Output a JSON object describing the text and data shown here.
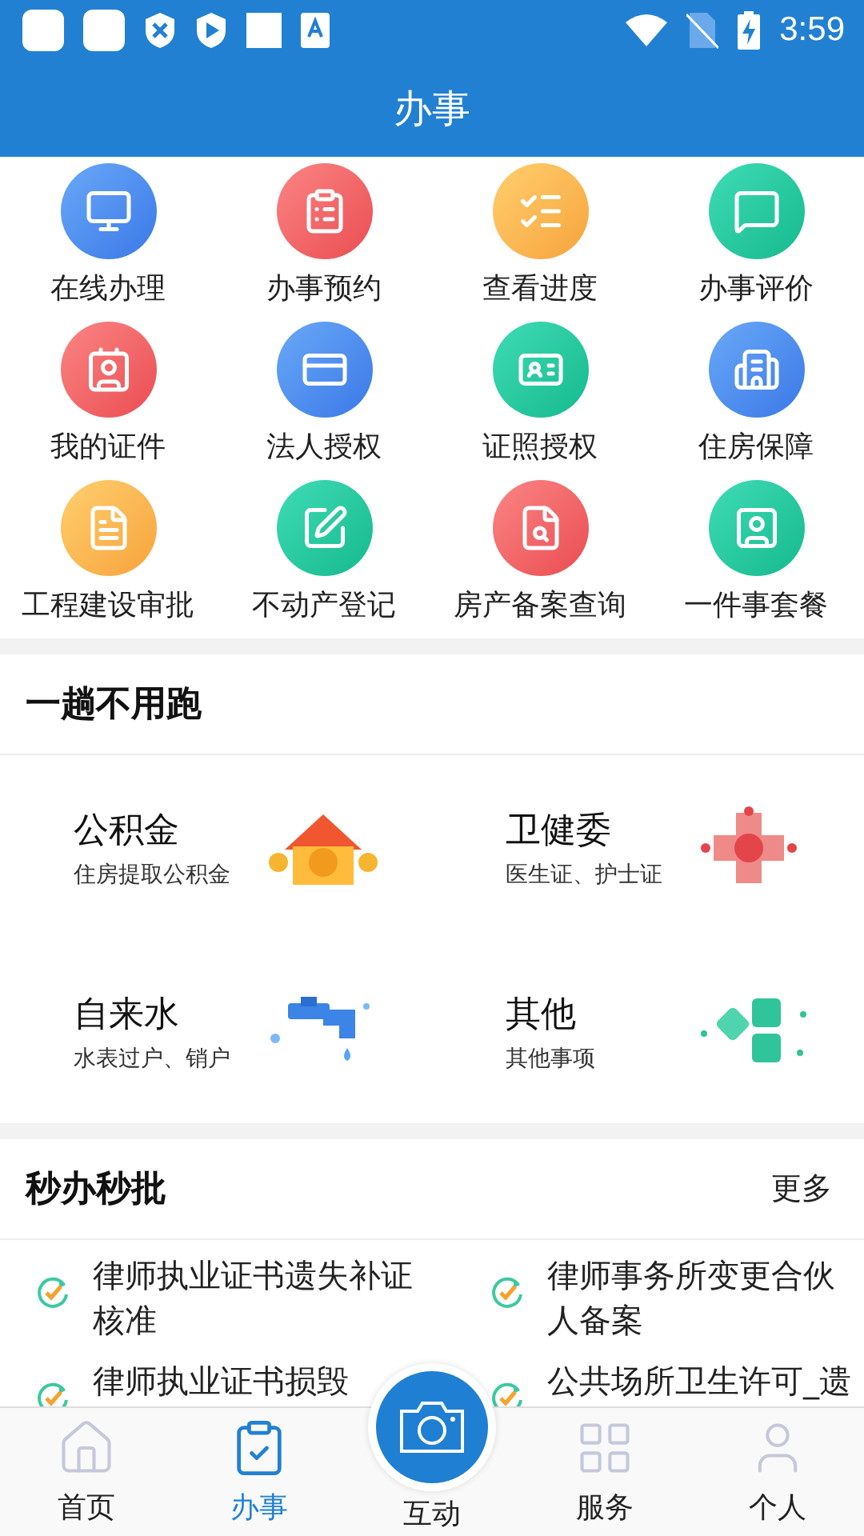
{
  "status_bar": {
    "time": "3:59"
  },
  "header": {
    "title": "办事"
  },
  "services": [
    {
      "label": "在线办理"
    },
    {
      "label": "办事预约"
    },
    {
      "label": "查看进度"
    },
    {
      "label": "办事评价"
    },
    {
      "label": "我的证件"
    },
    {
      "label": "法人授权"
    },
    {
      "label": "证照授权"
    },
    {
      "label": "住房保障"
    },
    {
      "label": "工程建设审批"
    },
    {
      "label": "不动产登记"
    },
    {
      "label": "房产备案查询"
    },
    {
      "label": "一件事套餐"
    }
  ],
  "no_trip": {
    "title": "一趟不用跑",
    "cards": [
      {
        "kind": "house",
        "title": "公积金",
        "subtitle": "住房提取公积金"
      },
      {
        "kind": "cross",
        "title": "卫健委",
        "subtitle": "医生证、护士证"
      },
      {
        "kind": "faucet",
        "title": "自来水",
        "subtitle": "水表过户、销户"
      },
      {
        "kind": "tiles",
        "title": "其他",
        "subtitle": "其他事项"
      }
    ]
  },
  "instant": {
    "title": "秒办秒批",
    "more": "更多",
    "items": [
      {
        "text": "律师执业证书遗失补证核准"
      },
      {
        "text": "律师事务所变更合伙人备案"
      },
      {
        "text": "律师执业证书损毁"
      },
      {
        "text": "公共场所卫生许可_遗"
      }
    ]
  },
  "tab_bar": [
    {
      "kind": "home",
      "label": "首页",
      "selected": false
    },
    {
      "kind": "clipboard",
      "label": "办事",
      "selected": true
    },
    {
      "kind": "camera",
      "label": "互动",
      "selected": false
    },
    {
      "kind": "grid",
      "label": "服务",
      "selected": false
    },
    {
      "kind": "person",
      "label": "个人",
      "selected": false
    }
  ]
}
